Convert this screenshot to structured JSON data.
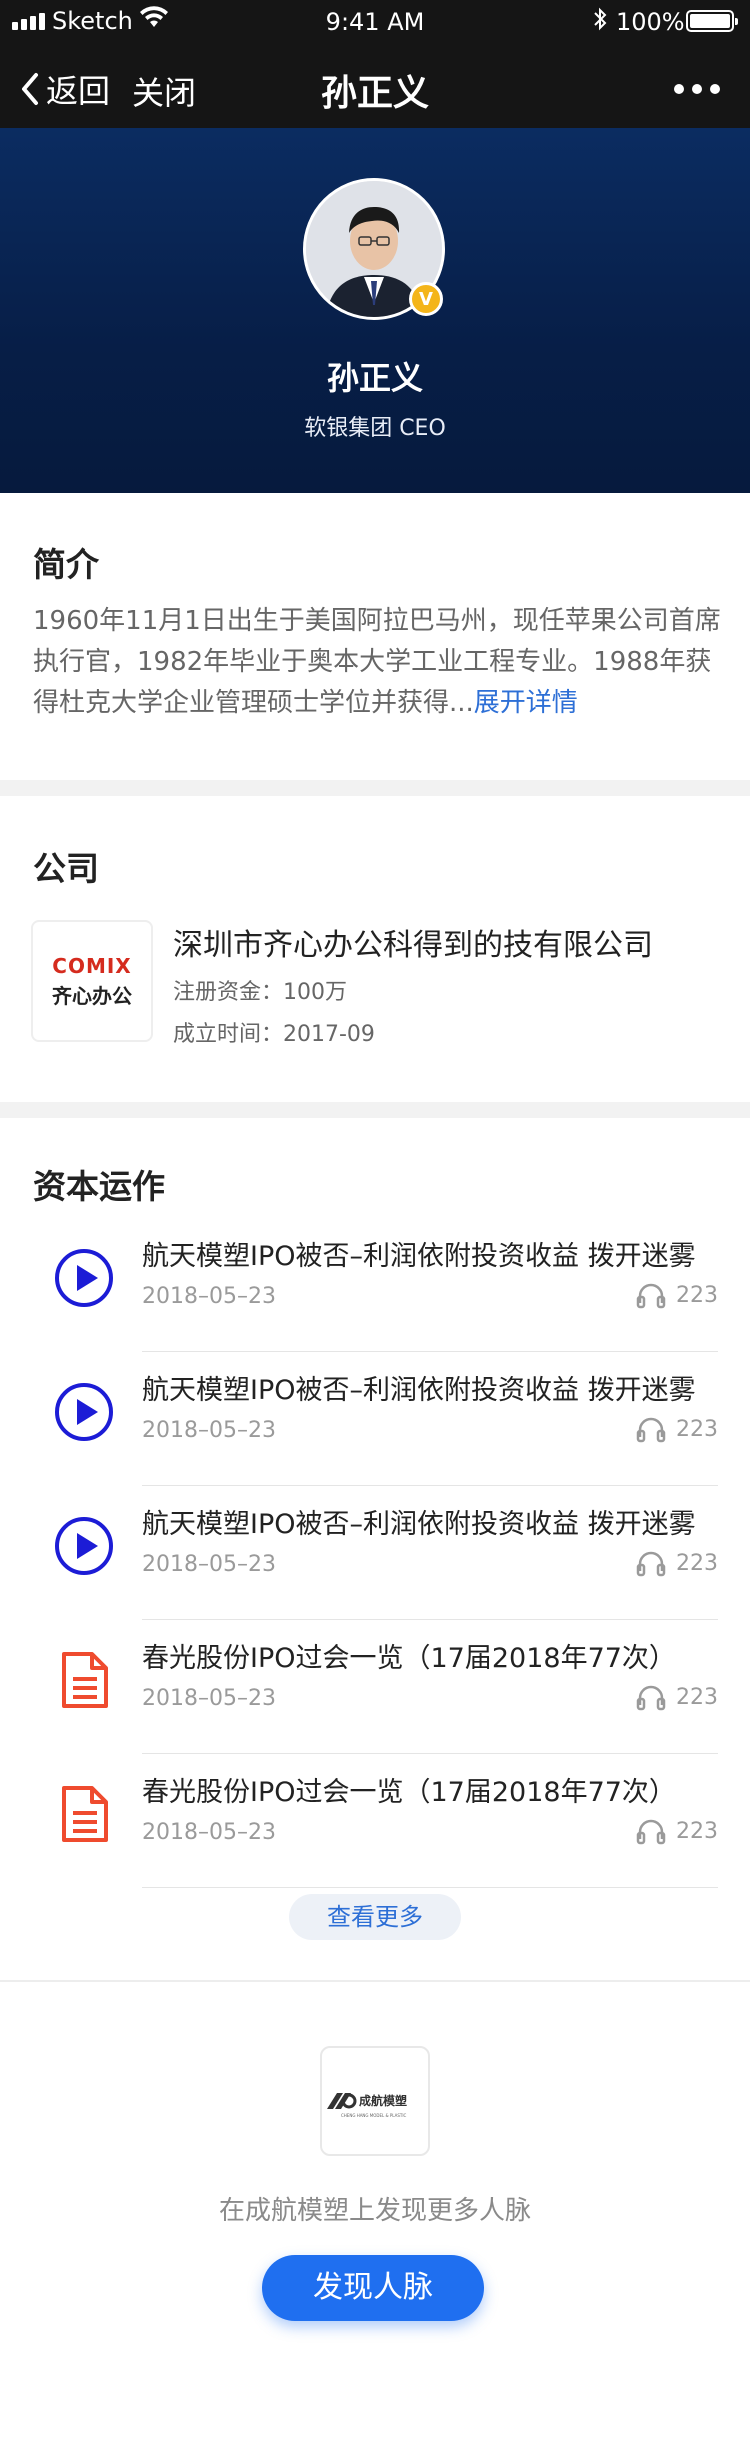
{
  "status_bar": {
    "carrier": "Sketch",
    "time": "9:41 AM",
    "battery": "100%"
  },
  "nav": {
    "back_label": "返回",
    "close_label": "关闭",
    "title": "孙正义"
  },
  "profile": {
    "name": "孙正义",
    "org": "软银集团 CEO",
    "verified_mark": "V"
  },
  "intro": {
    "heading": "简介",
    "text": "1960年11月1日出生于美国阿拉巴马州，现任苹果公司首席执行官，1982年毕业于奥本大学工业工程专业。1988年获得杜克大学企业管理硕士学位并获得...",
    "expand_label": "展开详情"
  },
  "company": {
    "heading": "公司",
    "logo_line1": "COMIX",
    "logo_line2": "齐心办公",
    "name": "深圳市齐心办公科得到的技有限公司",
    "capital": "注册资金：100万",
    "founded": "成立时间：2017-09"
  },
  "capital": {
    "heading": "资本运作",
    "items": [
      {
        "type": "audio",
        "title": "航天模塑IPO被否–利润依附投资收益 拨开迷雾",
        "date": "2018–05–23",
        "count": "223"
      },
      {
        "type": "audio",
        "title": "航天模塑IPO被否–利润依附投资收益 拨开迷雾",
        "date": "2018–05–23",
        "count": "223"
      },
      {
        "type": "audio",
        "title": "航天模塑IPO被否–利润依附投资收益 拨开迷雾",
        "date": "2018–05–23",
        "count": "223"
      },
      {
        "type": "doc",
        "title": "春光股份IPO过会一览（17届2018年77次）",
        "date": "2018–05–23",
        "count": "223"
      },
      {
        "type": "doc",
        "title": "春光股份IPO过会一览（17届2018年77次）",
        "date": "2018–05–23",
        "count": "223"
      }
    ],
    "more_label": "查看更多"
  },
  "footer": {
    "brand_name": "成航模塑",
    "brand_sub": "CHENG HANG MODEL & PLASTIC",
    "text": "在成航模塑上发现更多人脉",
    "cta_label": "发现人脉"
  },
  "colors": {
    "accent": "#1f6ff0",
    "link": "#2d6fd6",
    "doc_icon": "#ef4b2e",
    "hero_bg": "#071e47",
    "play_icon": "#1c1cd6"
  }
}
